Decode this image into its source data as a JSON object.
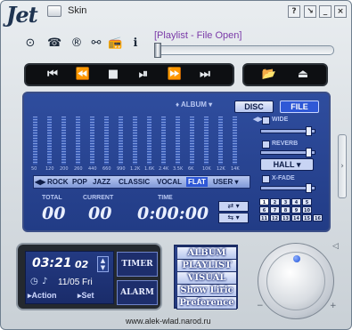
{
  "title_bar": {
    "logo_text": "Jet",
    "skin_label": "Skin",
    "help_label": "?",
    "mini_label": "↘",
    "minimize_label": "_",
    "close_label": "×"
  },
  "playlist": {
    "status_label": "[Playlist - File Open]"
  },
  "transport": {
    "prev": "⏮",
    "rewind": "⏪",
    "stop": "■",
    "play_pause": "⏯",
    "forward": "⏩",
    "next": "⏭",
    "open": "📂",
    "eject": "⏏"
  },
  "eq": {
    "mode_label": "♦ ALBUM ▾",
    "disc_label": "DISC",
    "file_label": "FILE",
    "freqs": [
      "50",
      "120",
      "200",
      "260",
      "440",
      "660",
      "990",
      "1.2K",
      "1.6K",
      "2.4K",
      "3.5K",
      "6K",
      "10K",
      "12K",
      "14K"
    ],
    "presets": [
      "◀▶",
      "ROCK",
      "POP",
      "JAZZ",
      "CLASSIC",
      "VOCAL",
      "FLAT",
      "USER ▾"
    ],
    "active_preset": "FLAT"
  },
  "effects": {
    "wide_label": "WIDE",
    "reverb_label": "REVERB",
    "reverb_mode": "HALL",
    "xfade_label": "X-FADE",
    "grid": [
      "1",
      "2",
      "3",
      "4",
      "5",
      "6",
      "7",
      "8",
      "9",
      "10",
      "11",
      "12",
      "13",
      "14",
      "15",
      "16"
    ]
  },
  "counters": {
    "total_label": "TOTAL",
    "total_value": "00",
    "current_label": "CURRENT",
    "current_value": "00",
    "time_label": "TIME",
    "time_value": "0:00:00"
  },
  "clock": {
    "time": "03:21",
    "seconds": "02",
    "date": "11/05 Fri",
    "action_label": "▸Action",
    "set_label": "▸Set",
    "timer_label": "TIMER",
    "alarm_label": "ALARM"
  },
  "menu": {
    "items": [
      "ALBUM",
      "PLAYLIST",
      "VISUAL",
      "Show Liric",
      "Preference"
    ]
  },
  "footer": {
    "url": "www.alek-wlad.narod.ru"
  },
  "colors": {
    "panel": "#2f4d9e",
    "file_button": "#2f58d6",
    "playlist_text": "#7a3aa8"
  }
}
